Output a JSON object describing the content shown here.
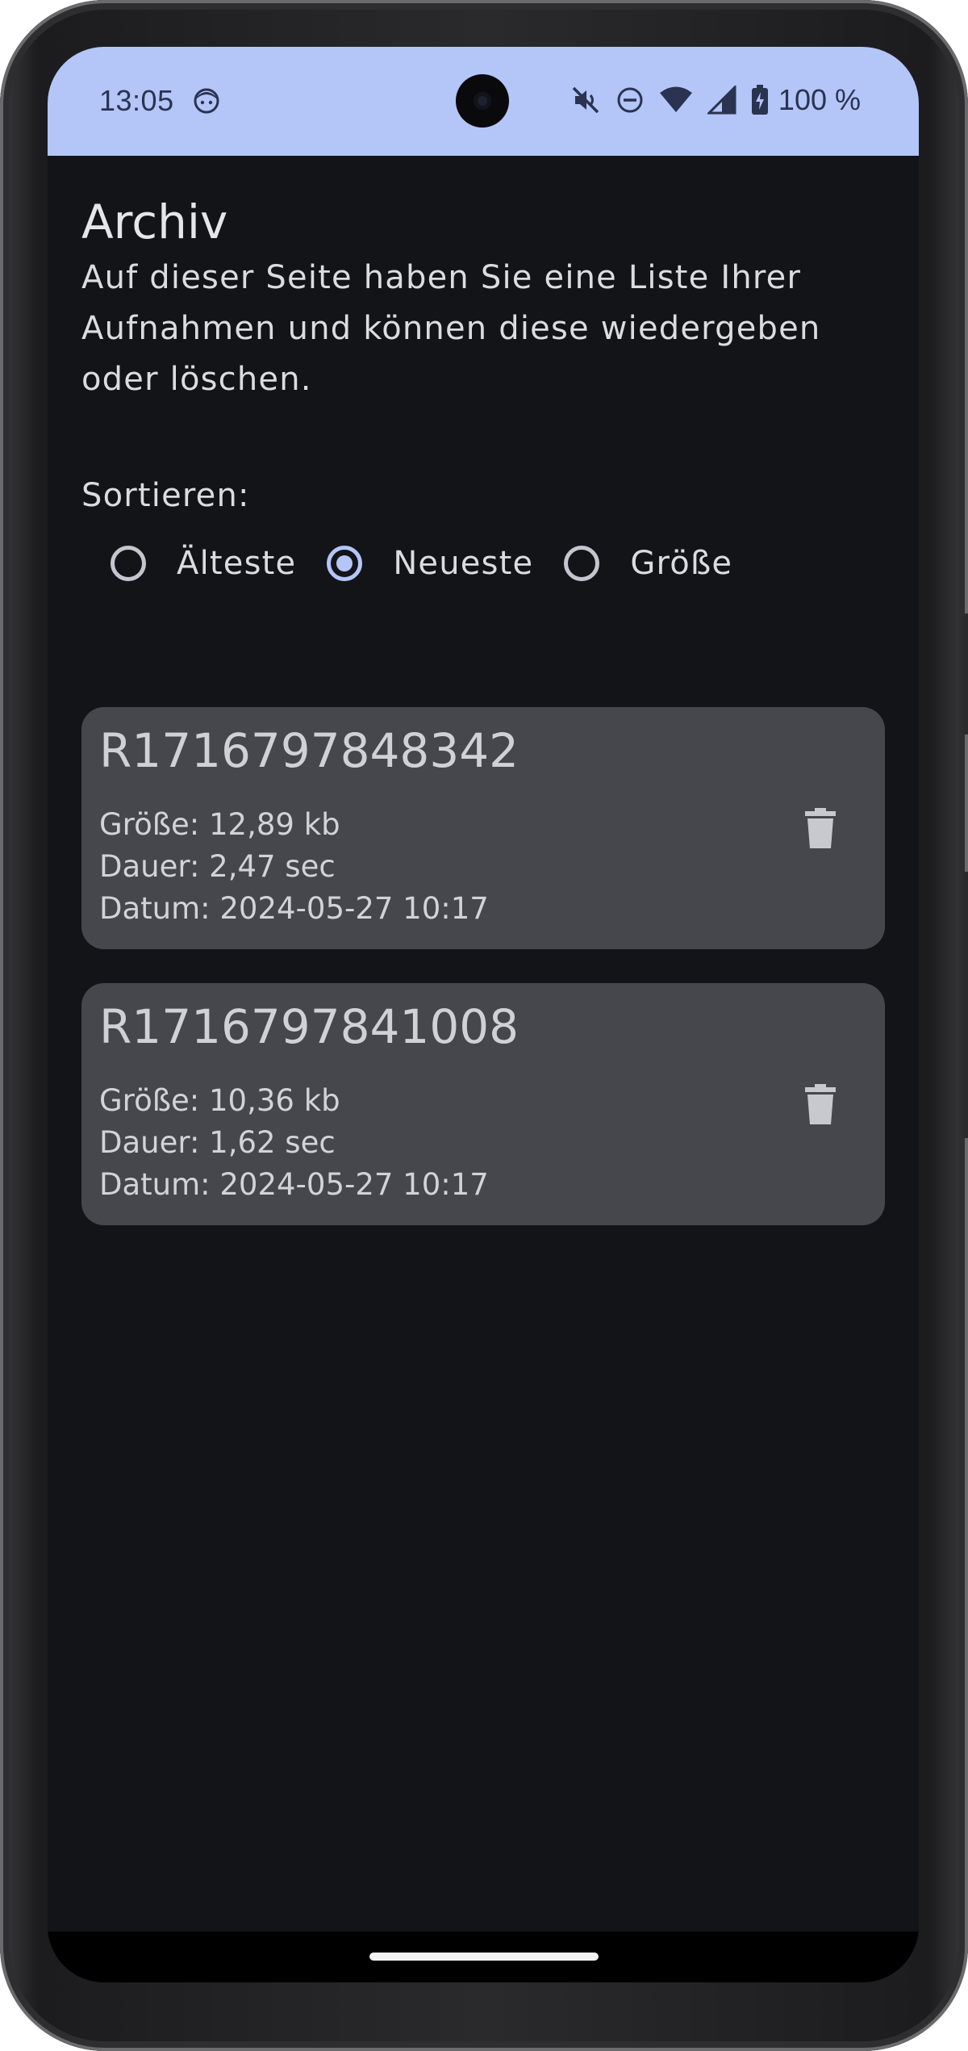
{
  "status_bar": {
    "time": "13:05",
    "battery": "100 %",
    "icons": [
      "face-icon",
      "mute-icon",
      "do-not-disturb-icon",
      "wifi-icon",
      "signal-icon",
      "battery-charging-icon"
    ]
  },
  "page": {
    "title": "Archiv",
    "description": "Auf dieser Seite haben Sie eine Liste Ihrer Aufnahmen und können diese wiedergeben oder löschen.",
    "sort_label": "Sortieren:"
  },
  "sort_options": [
    {
      "label": "Älteste",
      "selected": false
    },
    {
      "label": "Neueste",
      "selected": true
    },
    {
      "label": "Größe",
      "selected": false
    }
  ],
  "recordings": [
    {
      "name": "R1716797848342",
      "size": "Größe: 12,89 kb",
      "duration": "Dauer: 2,47 sec",
      "date": "Datum: 2024-05-27 10:17"
    },
    {
      "name": "R1716797841008",
      "size": "Größe: 10,36 kb",
      "duration": "Dauer: 1,62 sec",
      "date": "Datum: 2024-05-27 10:17"
    }
  ],
  "colors": {
    "accent": "#b4c5f8",
    "background": "#131418",
    "card": "#46474c"
  }
}
